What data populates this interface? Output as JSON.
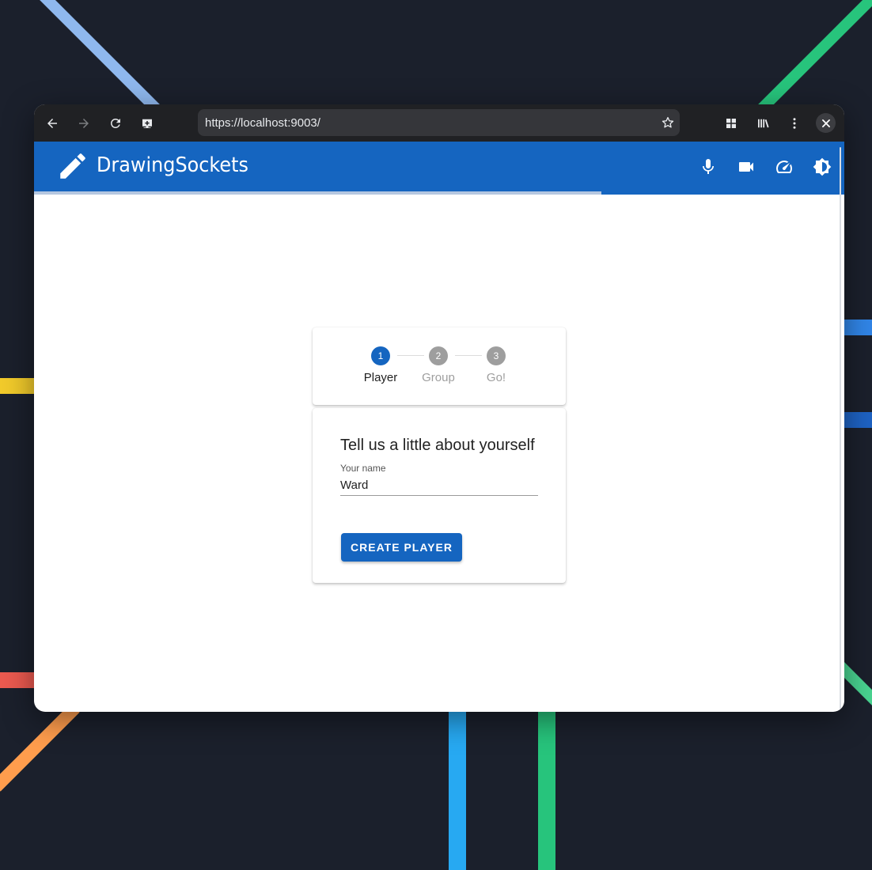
{
  "browser": {
    "url": "https://localhost:9003/",
    "icons": {
      "back": "arrow-left-icon",
      "forward": "arrow-right-icon",
      "reload": "reload-icon",
      "screencast": "cast-icon",
      "bookmark": "star-icon",
      "apps": "grid-icon",
      "library": "library-icon",
      "menu": "kebab-menu-icon",
      "close": "close-icon"
    }
  },
  "app": {
    "title": "DrawingSockets",
    "brand_color": "#1565c0",
    "icons": [
      "pencil-icon",
      "microphone-icon",
      "video-camera-icon",
      "speedometer-icon",
      "brightness-icon"
    ],
    "progress": 0.7
  },
  "stepper": {
    "steps": [
      {
        "number": "1",
        "label": "Player",
        "active": true
      },
      {
        "number": "2",
        "label": "Group",
        "active": false
      },
      {
        "number": "3",
        "label": "Go!",
        "active": false
      }
    ]
  },
  "form": {
    "heading": "Tell us a little about yourself",
    "name_label": "Your name",
    "name_value": "Ward",
    "submit_label": "CREATE PLAYER"
  }
}
